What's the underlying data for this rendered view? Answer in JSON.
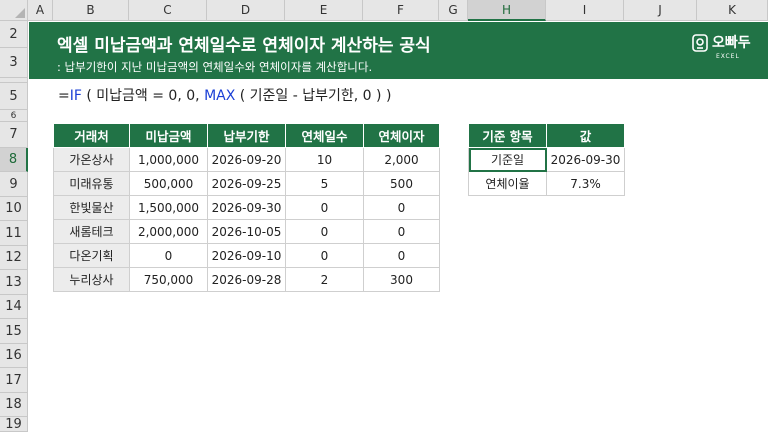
{
  "columns": [
    "A",
    "B",
    "C",
    "D",
    "E",
    "F",
    "G",
    "H",
    "I",
    "J",
    "K"
  ],
  "rows": [
    "2",
    "3",
    "5",
    "6",
    "7",
    "8",
    "9",
    "10",
    "11",
    "12",
    "13",
    "14",
    "15",
    "16",
    "17",
    "18",
    "19"
  ],
  "banner": {
    "title": "엑셀 미납금액과 연체일수로 연체이자 계산하는 공식",
    "subtitle": ": 납부기한이 지난 미납금액의 연체일수와 연체이자를 계산합니다.",
    "logo_text": "오빠두",
    "logo_sub": "EXCEL",
    "bg_color": "#217346"
  },
  "formula": {
    "eq": "=",
    "fn1": "IF",
    "part1": " ( 미납금액 = 0, 0, ",
    "fn2": "MAX",
    "part2": " ( 기준일 - 납부기한, 0 ) )"
  },
  "main_table": {
    "headers": [
      "거래처",
      "미납금액",
      "납부기한",
      "연체일수",
      "연체이자"
    ],
    "rows": [
      [
        "가온상사",
        "1,000,000",
        "2026-09-20",
        "10",
        "2,000"
      ],
      [
        "미래유통",
        "500,000",
        "2026-09-25",
        "5",
        "500"
      ],
      [
        "한빛물산",
        "1,500,000",
        "2026-09-30",
        "0",
        "0"
      ],
      [
        "새롬테크",
        "2,000,000",
        "2026-10-05",
        "0",
        "0"
      ],
      [
        "다온기획",
        "0",
        "2026-09-10",
        "0",
        "0"
      ],
      [
        "누리상사",
        "750,000",
        "2026-09-28",
        "2",
        "300"
      ]
    ]
  },
  "ref_table": {
    "headers": [
      "기준 항목",
      "값"
    ],
    "rows": [
      [
        "기준일",
        "2026-09-30"
      ],
      [
        "연체이율",
        "7.3%"
      ]
    ]
  },
  "selected": {
    "column": "H",
    "row": "8"
  }
}
